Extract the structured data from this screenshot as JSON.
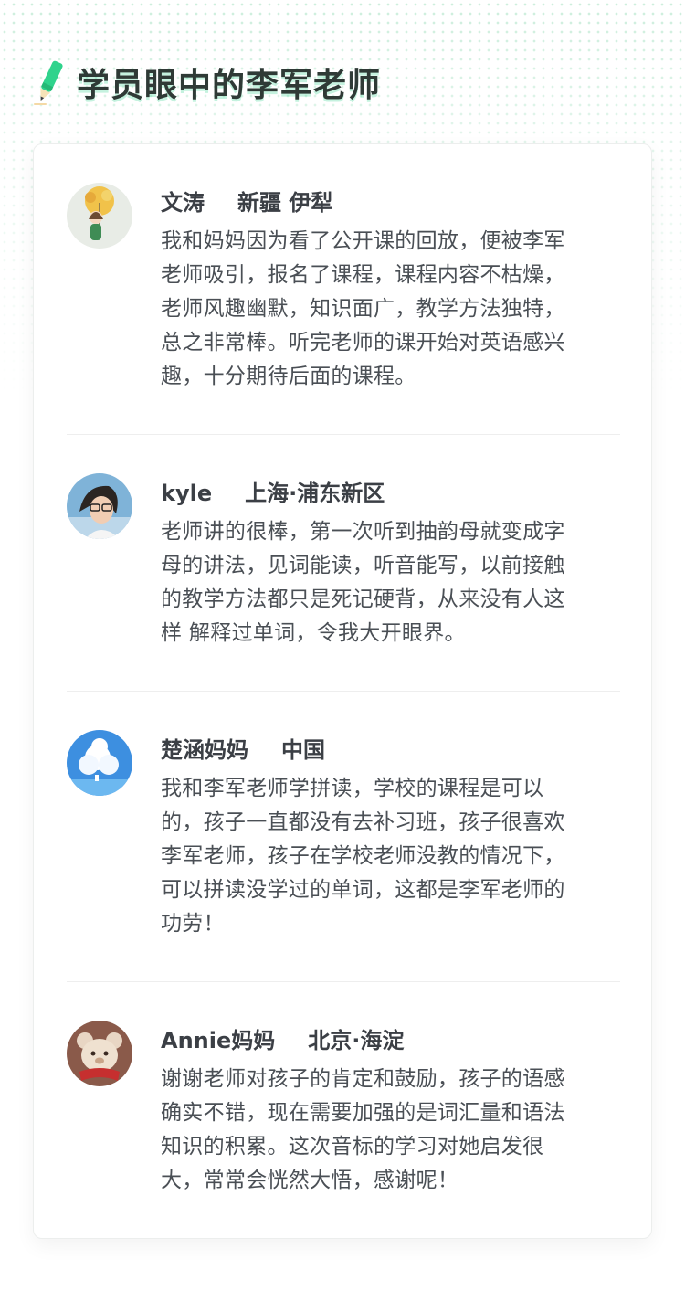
{
  "page": {
    "title": "学员眼中的李军老师"
  },
  "icons": {
    "title_icon": "pencil-icon"
  },
  "colors": {
    "accent": "#2fd38c",
    "text_primary": "#3b3f45",
    "text_body": "#4a4f55"
  },
  "reviews": [
    {
      "name": "文涛",
      "location": "新疆 伊犁",
      "avatar": "avatar-girl-umbrella",
      "lines": [
        "我和妈妈因为看了公开课的回放，便被李军",
        "老师吸引，报名了课程，课程内容不枯燥，",
        "老师风趣幽默，知识面广，教学方法独特，",
        "总之非常棒。听完老师的课开始对英语感兴",
        "趣，十分期待后面的课程。"
      ]
    },
    {
      "name": "kyle",
      "location": "上海·浦东新区",
      "avatar": "avatar-woman-glasses",
      "lines": [
        "老师讲的很棒，第一次听到抽韵母就变成字",
        "母的讲法，见词能读，听音能写，以前接触",
        "的教学方法都只是死记硬背，从来没有人这",
        "样 解释过单词，令我大开眼界。"
      ]
    },
    {
      "name": "楚涵妈妈",
      "location": "中国",
      "avatar": "avatar-sky-clouds",
      "lines": [
        "我和李军老师学拼读，学校的课程是可以",
        "的，孩子一直都没有去补习班，孩子很喜欢",
        "李军老师，孩子在学校老师没教的情况下，",
        "可以拼读没学过的单词，这都是李军老师的",
        "功劳！"
      ]
    },
    {
      "name": "Annie妈妈",
      "location": "北京·海淀",
      "avatar": "avatar-teddy-bear",
      "lines": [
        "谢谢老师对孩子的肯定和鼓励，孩子的语感",
        "确实不错，现在需要加强的是词汇量和语法",
        "知识的积累。这次音标的学习对她启发很",
        "大，常常会恍然大悟，感谢呢！"
      ]
    }
  ]
}
